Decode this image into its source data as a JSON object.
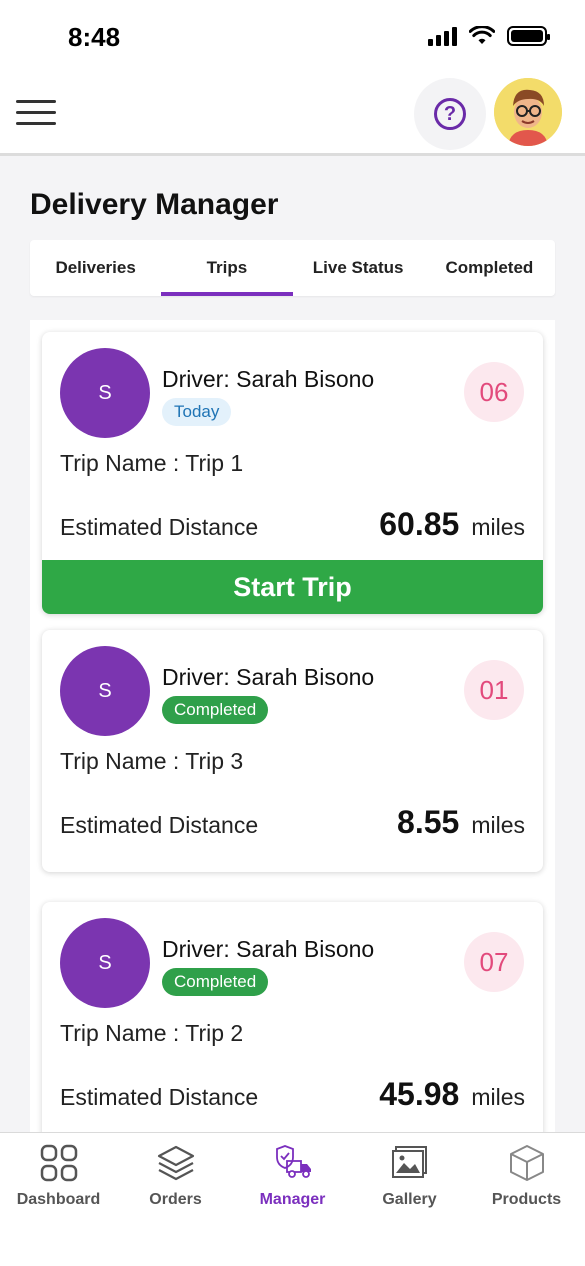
{
  "status_bar": {
    "time": "8:48"
  },
  "page_title": "Delivery Manager",
  "tabs": [
    {
      "label": "Deliveries",
      "active": false
    },
    {
      "label": "Trips",
      "active": true
    },
    {
      "label": "Live Status",
      "active": false
    },
    {
      "label": "Completed",
      "active": false
    }
  ],
  "trips": [
    {
      "avatar_initial": "S",
      "driver": "Driver: Sarah Bisono",
      "badge": "Today",
      "count": "06",
      "trip_name": "Trip Name : Trip 1",
      "distance_label": "Estimated Distance",
      "distance_value": "60.85",
      "distance_unit": "miles",
      "action": "Start Trip"
    },
    {
      "avatar_initial": "S",
      "driver": "Driver: Sarah Bisono",
      "badge": "Completed",
      "count": "01",
      "trip_name": "Trip Name : Trip 3",
      "distance_label": "Estimated Distance",
      "distance_value": "8.55",
      "distance_unit": "miles"
    },
    {
      "avatar_initial": "S",
      "driver": "Driver: Sarah Bisono",
      "badge": "Completed",
      "count": "07",
      "trip_name": "Trip Name : Trip 2",
      "distance_label": "Estimated Distance",
      "distance_value": "45.98",
      "distance_unit": "miles"
    }
  ],
  "bottom_nav": [
    {
      "label": "Dashboard",
      "icon": "grid-icon",
      "active": false
    },
    {
      "label": "Orders",
      "icon": "layers-icon",
      "active": false
    },
    {
      "label": "Manager",
      "icon": "delivery-truck-icon",
      "active": true
    },
    {
      "label": "Gallery",
      "icon": "image-icon",
      "active": false
    },
    {
      "label": "Products",
      "icon": "box-icon",
      "active": false
    }
  ],
  "colors": {
    "accent": "#7b2fbe",
    "success": "#2fa846",
    "count_bg": "#fce8ee",
    "count_text": "#e24a7c"
  }
}
